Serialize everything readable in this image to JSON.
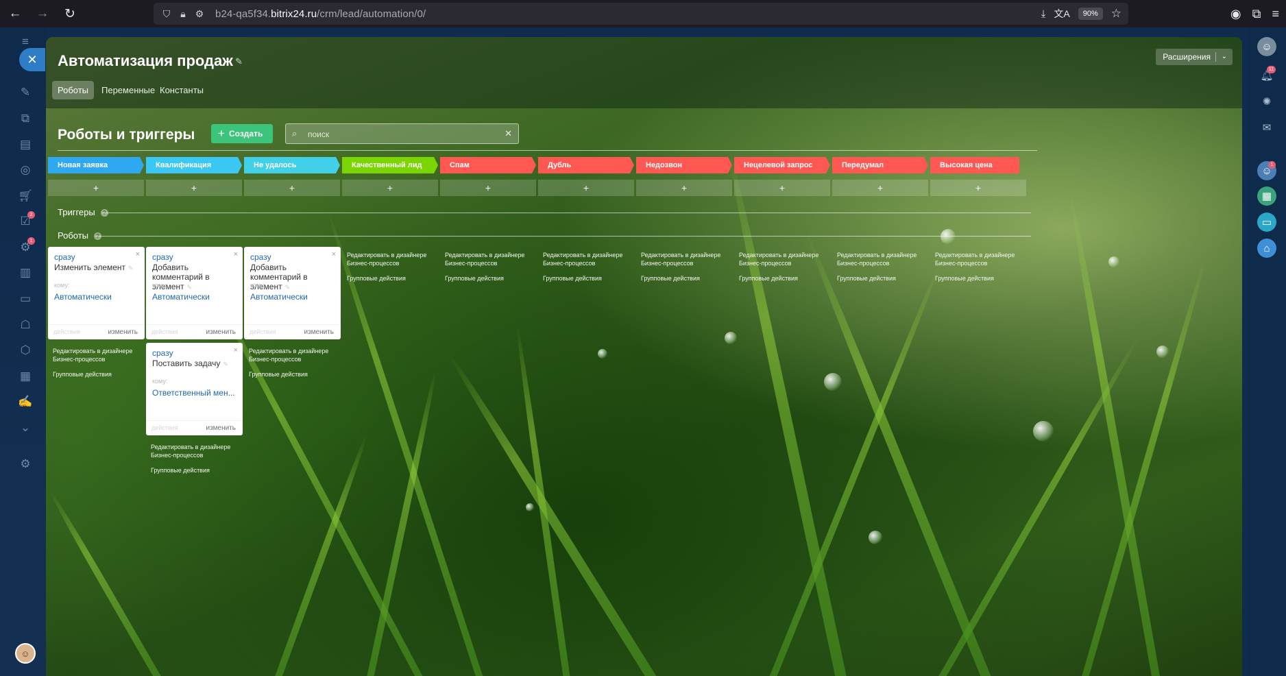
{
  "browser": {
    "url_prefix": "b24-qa5f34.",
    "url_domain": "bitrix24.ru",
    "url_path": "/crm/lead/automation/0/",
    "zoom": "90%"
  },
  "panel": {
    "title": "Автоматизация продаж",
    "tabs": [
      {
        "label": "Роботы",
        "active": true
      },
      {
        "label": "Переменные",
        "active": false
      },
      {
        "label": "Константы",
        "active": false
      }
    ],
    "extensions_label": "Расширения"
  },
  "main": {
    "heading": "Роботы и триггеры",
    "create_label": "Создать",
    "search_placeholder": "поиск",
    "add_symbol": "+",
    "triggers_label": "Триггеры",
    "robots_label": "Роботы",
    "help_symbol": "?"
  },
  "stages": [
    {
      "label": "Новая заявка",
      "color": "#2fa8f2"
    },
    {
      "label": "Квалификация",
      "color": "#3cc8f5"
    },
    {
      "label": "Не удалось дозвониться",
      "color": "#41d0e8"
    },
    {
      "label": "Качественный лид",
      "color": "#7bd500"
    },
    {
      "label": "Спам",
      "color": "#ff5752"
    },
    {
      "label": "Дубль",
      "color": "#ff5752"
    },
    {
      "label": "Недозвон",
      "color": "#ff5752"
    },
    {
      "label": "Нецелевой запрос",
      "color": "#ff5752"
    },
    {
      "label": "Передумал",
      "color": "#ff5752"
    },
    {
      "label": "Высокая цена",
      "color": "#ff5752"
    }
  ],
  "cards": [
    {
      "time": "сразу",
      "name": "Изменить элемент",
      "to_label": "кому:",
      "responsible": "Автоматически",
      "actions": "действия",
      "edit": "изменить",
      "close": "×"
    },
    {
      "time": "сразу",
      "name": "Добавить комментарий в элемент",
      "to_label": "кому:",
      "responsible": "Автоматически",
      "actions": "действия",
      "edit": "изменить",
      "close": "×"
    },
    {
      "time": "сразу",
      "name": "Добавить комментарий в элемент",
      "to_label": "кому:",
      "responsible": "Автоматически",
      "actions": "действия",
      "edit": "изменить",
      "close": "×"
    },
    {
      "time": "сразу",
      "name": "Поставить задачу",
      "to_label": "кому:",
      "responsible": "Ответственный мен...",
      "actions": "действия",
      "edit": "изменить",
      "close": "×"
    }
  ],
  "column_links": {
    "designer_line1": "Редактировать в дизайнере",
    "designer_line2": "Бизнес-процессов",
    "group_actions": "Групповые действия"
  },
  "badges": {
    "tasks": "2",
    "automation": "1",
    "notifications": "11",
    "chat": "1"
  },
  "icons": [
    "back-icon",
    "forward-icon",
    "reload-icon",
    "shield-icon",
    "lock-icon",
    "permissions-icon",
    "download-icon",
    "translate-icon",
    "star-icon",
    "account-icon",
    "extensions-icon",
    "menu-icon",
    "pin-icon",
    "search-icon",
    "clear-icon",
    "close-icon",
    "pencil-icon",
    "help-icon"
  ]
}
